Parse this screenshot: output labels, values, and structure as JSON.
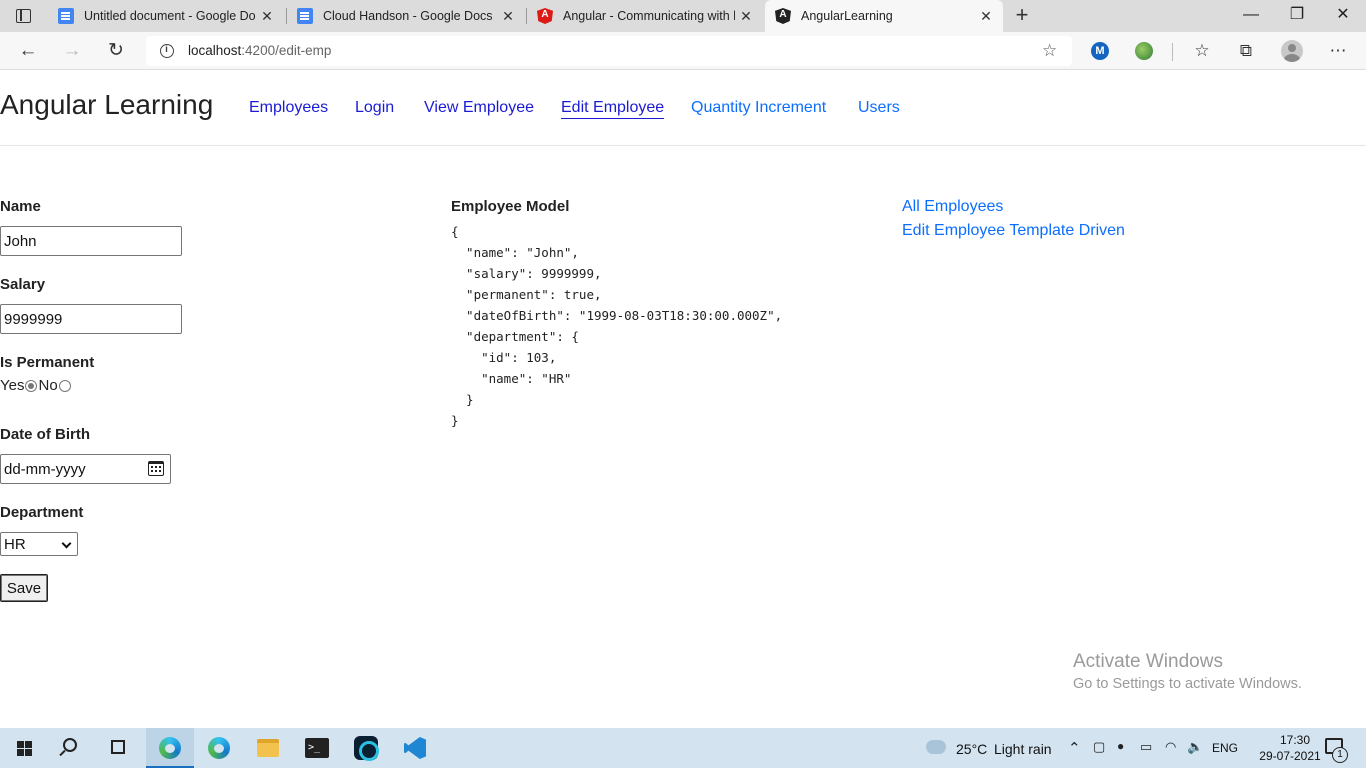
{
  "browser": {
    "tabs": [
      {
        "title": "Untitled document - Google Doc",
        "icon": "google-docs-icon"
      },
      {
        "title": "Cloud Handson - Google Docs",
        "icon": "google-docs-icon"
      },
      {
        "title": "Angular - Communicating with b",
        "icon": "angular-icon"
      },
      {
        "title": "AngularLearning",
        "icon": "angular-icon",
        "active": true
      }
    ],
    "close_glyph": "✕",
    "new_tab_glyph": "+",
    "window_controls": {
      "minimize": "—",
      "maximize": "❐",
      "close": "✕"
    },
    "nav": {
      "back": "←",
      "forward": "→",
      "reload": "↻"
    },
    "address": {
      "host": "localhost",
      "path": ":4200/edit-emp"
    },
    "toolbar_icons": {
      "add_favorite": "☆",
      "extension_m": "M",
      "favorites": "☆",
      "collections": "⧉",
      "more": "⋯"
    }
  },
  "site": {
    "brand": "Angular Learning",
    "nav": [
      {
        "label": "Employees"
      },
      {
        "label": "Login"
      },
      {
        "label": "View Employee"
      },
      {
        "label": "Edit Employee",
        "active": true
      },
      {
        "label": "Quantity Increment"
      },
      {
        "label": "Users"
      }
    ]
  },
  "form": {
    "name_label": "Name",
    "name_value": "John",
    "salary_label": "Salary",
    "salary_value": "9999999",
    "permanent_label": "Is Permanent",
    "permanent_yes": "Yes",
    "permanent_no": "No",
    "permanent_value": "Yes",
    "dob_label": "Date of Birth",
    "dob_placeholder": "dd-mm-yyyy",
    "department_label": "Department",
    "department_value": "HR",
    "save_label": "Save"
  },
  "model": {
    "title": "Employee Model",
    "json_text": "{\n  \"name\": \"John\",\n  \"salary\": 9999999,\n  \"permanent\": true,\n  \"dateOfBirth\": \"1999-08-03T18:30:00.000Z\",\n  \"department\": {\n    \"id\": 103,\n    \"name\": \"HR\"\n  }\n}"
  },
  "side_links": [
    {
      "label": "All Employees"
    },
    {
      "label": "Edit Employee Template Driven"
    }
  ],
  "watermark": {
    "title": "Activate Windows",
    "subtitle": "Go to Settings to activate Windows."
  },
  "taskbar": {
    "weather": {
      "temp": "25°C",
      "condition": "Light rain"
    },
    "language": "ENG",
    "time": "17:30",
    "date": "29-07-2021",
    "notification_count": "1",
    "terminal_glyph": ">_",
    "tray_glyphs": {
      "chevron": "⌃",
      "mic": "●",
      "volume": "🔈"
    }
  },
  "colors": {
    "link": "#0d6efd",
    "visited_link": "#1b1bd6",
    "taskbar": "#d3e3ef"
  }
}
